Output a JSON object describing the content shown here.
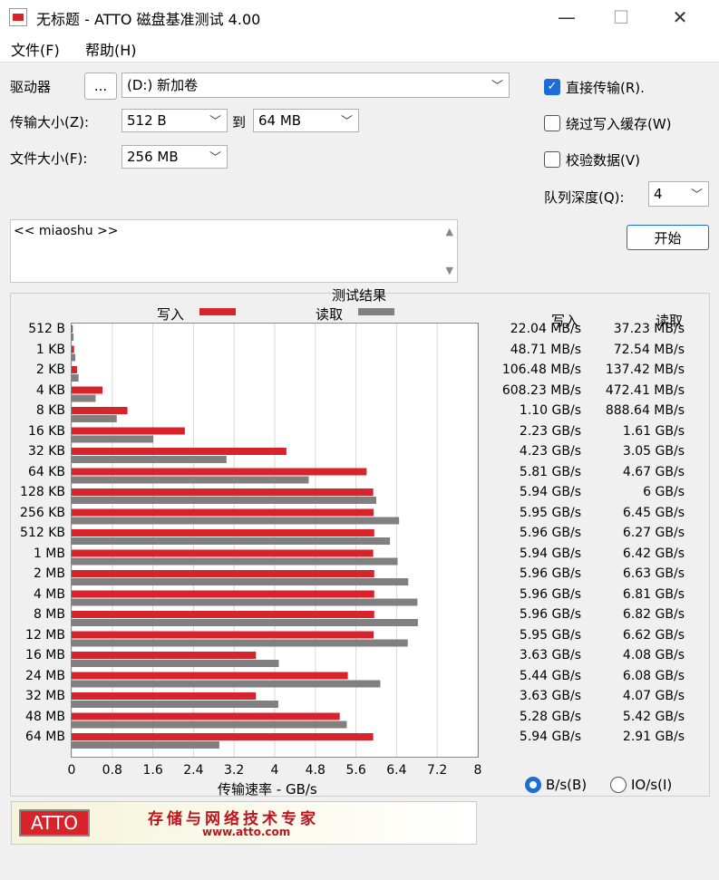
{
  "window": {
    "title": "无标题 - ATTO 磁盘基准测试 4.00",
    "minimize": "—",
    "maximize": "☐",
    "close": "✕"
  },
  "menu": [
    "文件(F)",
    "帮助(H)"
  ],
  "controls": {
    "drive_label": "驱动器",
    "browse_label": "...",
    "drive_value": "(D:) 新加卷",
    "transfer_label": "传输大小(Z):",
    "transfer_from": "512 B",
    "to_label": "到",
    "transfer_to": "64 MB",
    "file_size_label": "文件大小(F):",
    "file_size": "256 MB",
    "direct_io": "直接传输(R).",
    "bypass_cache": "绕过写入缓存(W)",
    "verify": "校验数据(V)",
    "queue_label": "队列深度(Q):",
    "queue_value": "4",
    "start": "开始",
    "description": "<< miaoshu >>"
  },
  "chart_data": {
    "type": "bar",
    "title": "测试结果",
    "xlabel": "传输速率 - GB/s",
    "xlim": [
      0,
      8
    ],
    "xticks": [
      "0",
      "0.8",
      "1.6",
      "2.4",
      "3.2",
      "4",
      "4.8",
      "5.6",
      "6.4",
      "7.2",
      "8"
    ],
    "categories": [
      "512 B",
      "1 KB",
      "2 KB",
      "4 KB",
      "8 KB",
      "16 KB",
      "32 KB",
      "64 KB",
      "128 KB",
      "256 KB",
      "512 KB",
      "1 MB",
      "2 MB",
      "4 MB",
      "8 MB",
      "12 MB",
      "16 MB",
      "24 MB",
      "32 MB",
      "48 MB",
      "64 MB"
    ],
    "series": [
      {
        "name": "写入",
        "color": "#d8232a",
        "values": [
          0.022,
          0.049,
          0.106,
          0.608,
          1.1,
          2.23,
          4.23,
          5.81,
          5.94,
          5.95,
          5.96,
          5.94,
          5.96,
          5.96,
          5.96,
          5.95,
          3.63,
          5.44,
          3.63,
          5.28,
          5.94
        ]
      },
      {
        "name": "读取",
        "color": "#808080",
        "values": [
          0.037,
          0.073,
          0.137,
          0.472,
          0.889,
          1.61,
          3.05,
          4.67,
          6,
          6.45,
          6.27,
          6.42,
          6.63,
          6.81,
          6.82,
          6.62,
          4.08,
          6.08,
          4.07,
          5.42,
          2.91
        ]
      }
    ]
  },
  "table": {
    "write_header": "写入",
    "read_header": "读取",
    "write": [
      "22.04 MB/s",
      "48.71 MB/s",
      "106.48 MB/s",
      "608.23 MB/s",
      "1.10 GB/s",
      "2.23 GB/s",
      "4.23 GB/s",
      "5.81 GB/s",
      "5.94 GB/s",
      "5.95 GB/s",
      "5.96 GB/s",
      "5.94 GB/s",
      "5.96 GB/s",
      "5.96 GB/s",
      "5.96 GB/s",
      "5.95 GB/s",
      "3.63 GB/s",
      "5.44 GB/s",
      "3.63 GB/s",
      "5.28 GB/s",
      "5.94 GB/s"
    ],
    "read": [
      "37.23 MB/s",
      "72.54 MB/s",
      "137.42 MB/s",
      "472.41 MB/s",
      "888.64 MB/s",
      "1.61 GB/s",
      "3.05 GB/s",
      "4.67 GB/s",
      "6 GB/s",
      "6.45 GB/s",
      "6.27 GB/s",
      "6.42 GB/s",
      "6.63 GB/s",
      "6.81 GB/s",
      "6.82 GB/s",
      "6.62 GB/s",
      "4.08 GB/s",
      "6.08 GB/s",
      "4.07 GB/s",
      "5.42 GB/s",
      "2.91 GB/s"
    ]
  },
  "units": {
    "bytes": "B/s(B)",
    "io": "IO/s(I)"
  },
  "banner": {
    "logo": "ATTO",
    "slogan": "存储与网络技术专家",
    "url": "www.atto.com"
  }
}
